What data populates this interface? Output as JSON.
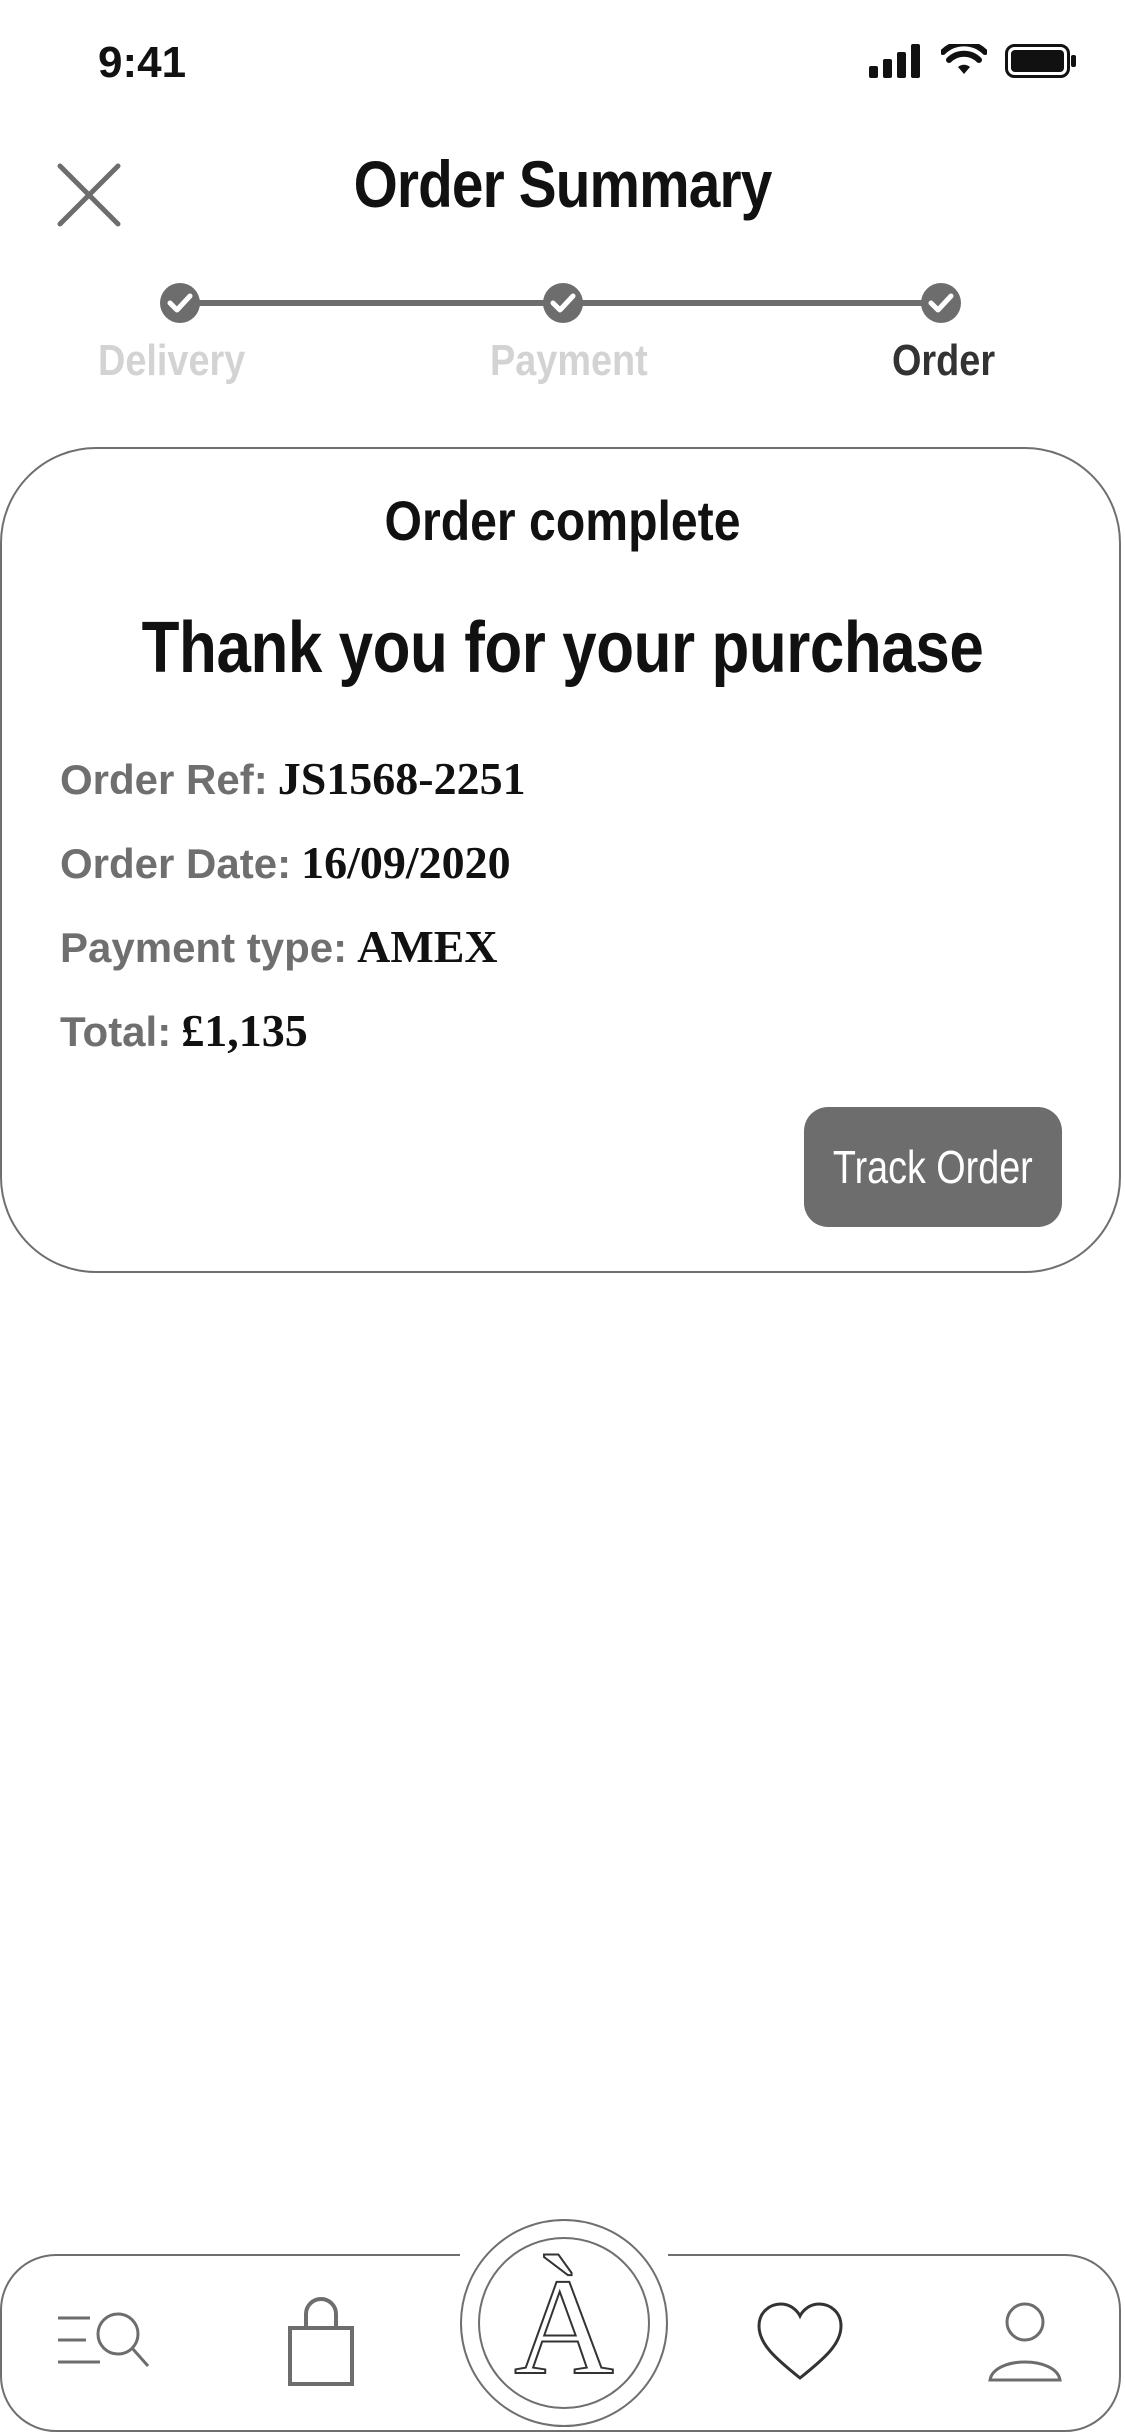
{
  "status_bar": {
    "time": "9:41"
  },
  "header": {
    "title": "Order Summary"
  },
  "stepper": {
    "steps": [
      {
        "label": "Delivery",
        "color": "#d3d3d3"
      },
      {
        "label": "Payment",
        "color": "#d3d3d3"
      },
      {
        "label": "Order",
        "color": "#333333"
      }
    ]
  },
  "card": {
    "title": "Order complete",
    "heading": "Thank you for your purchase",
    "rows": [
      {
        "label": "Order Ref:",
        "value": "JS1568-2251"
      },
      {
        "label": "Order Date:",
        "value": "16/09/2020"
      },
      {
        "label": "Payment type:",
        "value": "AMEX"
      },
      {
        "label": "Total:",
        "value": "£1,135"
      }
    ],
    "track_button": "Track Order"
  },
  "nav": {
    "logo_letter": "À",
    "items": [
      "menu-search-icon",
      "shopping-bag-icon",
      "logo",
      "heart-icon",
      "profile-icon"
    ]
  },
  "colors": {
    "accent": "#6d6d6d",
    "inactive_step": "#d3d3d3"
  }
}
